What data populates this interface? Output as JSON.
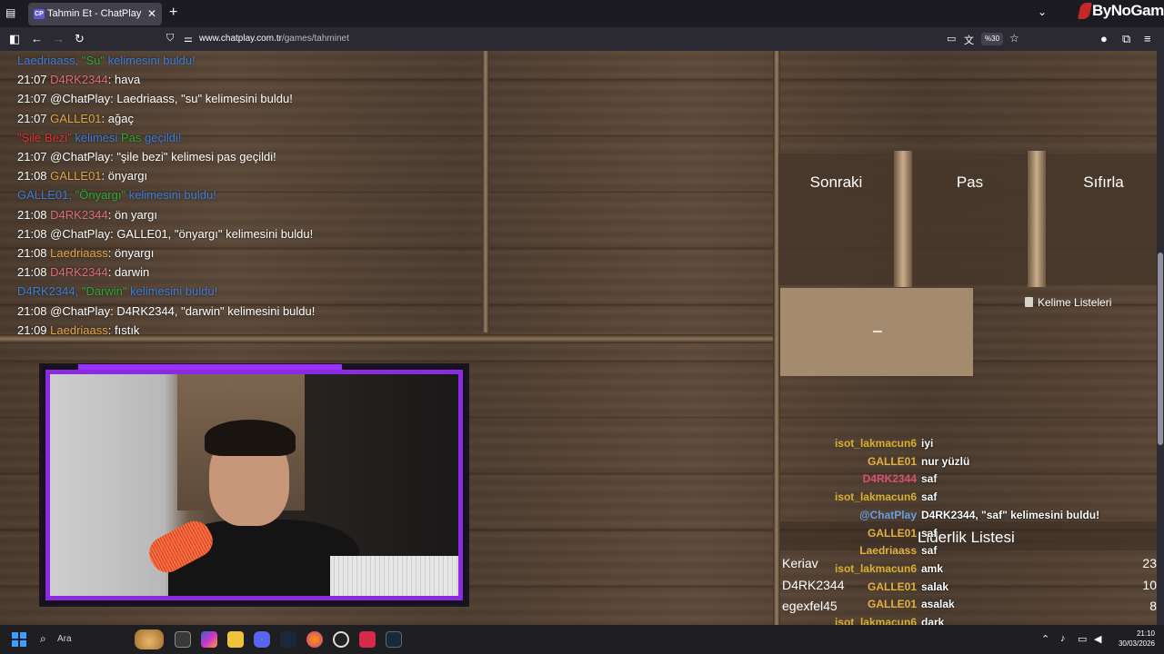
{
  "browser": {
    "tab_title": "Tahmin Et - ChatPlay",
    "tab_favicon": "CP",
    "url_domain": "www.chatplay.com.tr",
    "url_path": "/games/tahminet",
    "zoom": "%30",
    "watermark": "ByNoGame"
  },
  "chat": [
    {
      "parts": [
        {
          "t": "Laedriaass, ",
          "c": "sys"
        },
        {
          "t": "\"Su\"",
          "c": "green"
        },
        {
          "t": " kelimesini buldu!",
          "c": "sys"
        }
      ]
    },
    {
      "parts": [
        {
          "t": "21:07 ",
          "c": "plain"
        },
        {
          "t": "D4RK2344",
          "c": "d4rk"
        },
        {
          "t": ": hava",
          "c": "plain"
        }
      ]
    },
    {
      "parts": [
        {
          "t": "21:07 @ChatPlay: Laedriaass, \"su\" kelimesini buldu!",
          "c": "plain"
        }
      ]
    },
    {
      "parts": [
        {
          "t": "21:07 ",
          "c": "plain"
        },
        {
          "t": "GALLE01",
          "c": "galle"
        },
        {
          "t": ": ağaç",
          "c": "plain"
        }
      ]
    },
    {
      "parts": [
        {
          "t": "\"Şile Bezi\"",
          "c": "red"
        },
        {
          "t": " kelimesi ",
          "c": "sys"
        },
        {
          "t": "Pas",
          "c": "green"
        },
        {
          "t": " geçildi!",
          "c": "sys"
        }
      ]
    },
    {
      "parts": [
        {
          "t": "21:07 @ChatPlay: \"şile bezi\" kelimesi pas geçildi!",
          "c": "plain"
        }
      ]
    },
    {
      "parts": [
        {
          "t": "21:08 ",
          "c": "plain"
        },
        {
          "t": "GALLE01",
          "c": "galle"
        },
        {
          "t": ": önyargı",
          "c": "plain"
        }
      ]
    },
    {
      "parts": [
        {
          "t": "GALLE01, ",
          "c": "sys"
        },
        {
          "t": "\"Önyargı\"",
          "c": "green"
        },
        {
          "t": " kelimesini buldu!",
          "c": "sys"
        }
      ]
    },
    {
      "parts": [
        {
          "t": "21:08 ",
          "c": "plain"
        },
        {
          "t": "D4RK2344",
          "c": "d4rk"
        },
        {
          "t": ": ön yargı",
          "c": "plain"
        }
      ]
    },
    {
      "parts": [
        {
          "t": "21:08 @ChatPlay: GALLE01, \"önyargı\" kelimesini buldu!",
          "c": "plain"
        }
      ]
    },
    {
      "parts": [
        {
          "t": "21:08 ",
          "c": "plain"
        },
        {
          "t": "Laedriaass",
          "c": "galle"
        },
        {
          "t": ": önyargı",
          "c": "plain"
        }
      ]
    },
    {
      "parts": [
        {
          "t": "21:08 ",
          "c": "plain"
        },
        {
          "t": "D4RK2344",
          "c": "d4rk"
        },
        {
          "t": ": darwin",
          "c": "plain"
        }
      ]
    },
    {
      "parts": [
        {
          "t": "D4RK2344, ",
          "c": "sys"
        },
        {
          "t": "\"Darwin\"",
          "c": "green"
        },
        {
          "t": " kelimesini buldu!",
          "c": "sys"
        }
      ]
    },
    {
      "parts": [
        {
          "t": "21:08 @ChatPlay: D4RK2344, \"darwin\" kelimesini buldu!",
          "c": "plain"
        }
      ]
    },
    {
      "parts": [
        {
          "t": "21:09 ",
          "c": "plain"
        },
        {
          "t": "Laedriaass",
          "c": "galle"
        },
        {
          "t": ": fıstık",
          "c": "plain"
        }
      ]
    }
  ],
  "buttons": {
    "next": "Sonraki",
    "pass": "Pas",
    "reset": "Sıfırla"
  },
  "word_lists_label": "Kelime Listeleri",
  "overlay_chat": [
    {
      "user": "isot_lakmacun6",
      "u": "isot",
      "msg": "iyi"
    },
    {
      "user": "GALLE01",
      "u": "galle",
      "msg": "nur yüzlü"
    },
    {
      "user": "D4RK2344",
      "u": "d4rk",
      "msg": "saf"
    },
    {
      "user": "isot_lakmacun6",
      "u": "isot",
      "msg": "saf"
    },
    {
      "user": "@ChatPlay",
      "u": "chatplay",
      "msg": "D4RK2344, \"saf\" kelimesini buldu!"
    },
    {
      "user": "GALLE01",
      "u": "galle",
      "msg": "saf"
    },
    {
      "user": "Laedriaass",
      "u": "laed",
      "msg": "saf"
    },
    {
      "user": "isot_lakmacun6",
      "u": "isot",
      "msg": "amk"
    },
    {
      "user": "GALLE01",
      "u": "galle",
      "msg": "salak"
    },
    {
      "user": "GALLE01",
      "u": "galle",
      "msg": "asalak"
    },
    {
      "user": "isot_lakmacun6",
      "u": "isot",
      "msg": "dark"
    }
  ],
  "leaderboard": {
    "title": "Liderlik Listesi",
    "rows": [
      {
        "name": "Keriav",
        "score": "23"
      },
      {
        "name": "D4RK2344",
        "score": "10"
      },
      {
        "name": "egexfel45",
        "score": "8"
      }
    ]
  },
  "taskbar": {
    "search_placeholder": "Ara",
    "time": "21:10",
    "date": "30/03/2026"
  }
}
